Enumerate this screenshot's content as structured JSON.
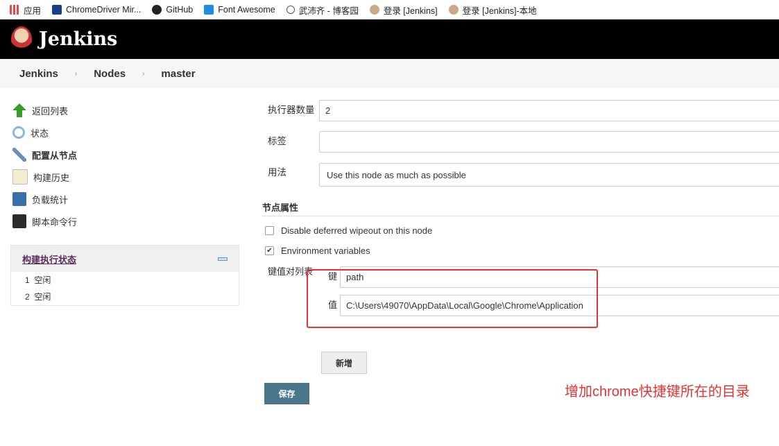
{
  "bookmarks": [
    {
      "label": "应用",
      "icon": "apps-grid-icon"
    },
    {
      "label": "ChromeDriver Mir...",
      "icon": "n-logo-icon"
    },
    {
      "label": "GitHub",
      "icon": "github-icon"
    },
    {
      "label": "Font Awesome",
      "icon": "flag-icon"
    },
    {
      "label": "武沛齐 - 博客园",
      "icon": "blog-icon"
    },
    {
      "label": "登录 [Jenkins]",
      "icon": "jenkins-icon"
    },
    {
      "label": "登录 [Jenkins]-本地",
      "icon": "jenkins-icon"
    }
  ],
  "header": {
    "title": "Jenkins"
  },
  "breadcrumb": [
    "Jenkins",
    "Nodes",
    "master"
  ],
  "sidebar": {
    "items": [
      {
        "label": "返回列表",
        "icon": "up-arrow-icon",
        "color": "#3c9a2c"
      },
      {
        "label": "状态",
        "icon": "search-icon",
        "color": "#8fb4d9"
      },
      {
        "label": "配置从节点",
        "icon": "tools-icon",
        "color": "#6b8fb8"
      },
      {
        "label": "构建历史",
        "icon": "notepad-icon",
        "color": "#e8d9a0"
      },
      {
        "label": "负载统计",
        "icon": "monitor-icon",
        "color": "#3a6ea8"
      },
      {
        "label": "脚本命令行",
        "icon": "terminal-icon",
        "color": "#2b2b2b"
      }
    ]
  },
  "executors": {
    "title": "构建执行状态",
    "rows": [
      {
        "num": "1",
        "status": "空闲"
      },
      {
        "num": "2",
        "status": "空闲"
      }
    ]
  },
  "form": {
    "executors_label": "执行器数量",
    "executors_value": "2",
    "labels_label": "标签",
    "labels_value": "",
    "usage_label": "用法",
    "usage_value": "Use this node as much as possible",
    "section": "节点属性",
    "cb1": "Disable deferred wipeout on this node",
    "cb1_checked": false,
    "cb2": "Environment variables",
    "cb2_checked": true,
    "kv_label": "键值对列表",
    "key_label": "键",
    "key_value": "path",
    "value_label": "值",
    "value_value": "C:\\Users\\49070\\AppData\\Local\\Google\\Chrome\\Application",
    "add_button": "新增",
    "save_button": "保存"
  },
  "annotation": {
    "text": "增加chrome快捷键所在的目录",
    "color": "#e53333"
  }
}
